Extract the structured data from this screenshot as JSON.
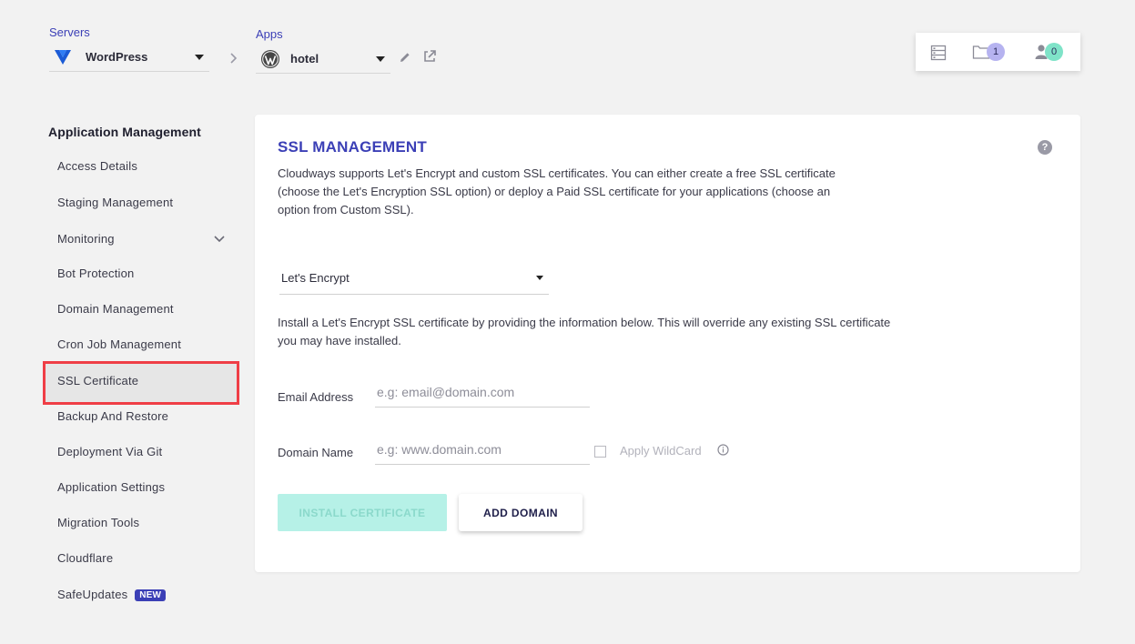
{
  "header": {
    "servers_label": "Servers",
    "server_name": "WordPress",
    "apps_label": "Apps",
    "app_name": "hotel",
    "projects_count": "1",
    "team_count": "0"
  },
  "sidebar": {
    "title": "Application Management",
    "items": [
      {
        "label": "Access Details"
      },
      {
        "label": "Staging Management"
      },
      {
        "label": "Monitoring"
      },
      {
        "label": "Bot Protection"
      },
      {
        "label": "Domain Management"
      },
      {
        "label": "Cron Job Management"
      },
      {
        "label": "SSL Certificate"
      },
      {
        "label": "Backup And Restore"
      },
      {
        "label": "Deployment Via Git"
      },
      {
        "label": "Application Settings"
      },
      {
        "label": "Migration Tools"
      },
      {
        "label": "Cloudflare"
      },
      {
        "label": "SafeUpdates",
        "badge": "NEW"
      }
    ],
    "active": "SSL Certificate"
  },
  "main": {
    "title": "SSL MANAGEMENT",
    "description": "Cloudways supports Let's Encrypt and custom SSL certificates. You can either create a free SSL certificate (choose the Let's Encryption SSL option) or deploy a Paid SSL certificate for your applications (choose an option from Custom SSL).",
    "ssl_type": "Let's Encrypt",
    "install_description": "Install a Let's Encrypt SSL certificate by providing the information below. This will override any existing SSL certificate you may have installed.",
    "email_label": "Email Address",
    "email_placeholder": "e.g: email@domain.com",
    "domain_label": "Domain Name",
    "domain_placeholder": "e.g: www.domain.com",
    "wildcard_label": "Apply WildCard",
    "install_button": "INSTALL CERTIFICATE",
    "add_domain_button": "ADD DOMAIN"
  },
  "colors": {
    "brand": "#3b3fb6",
    "active_outline": "#ef3e46",
    "projects_badge": "#b6b3f0",
    "team_badge": "#7fe3c8",
    "install_bg": "#b6f1e7"
  },
  "icons": [
    "digitalocean-logo-icon",
    "chevron-right-icon",
    "wordpress-logo-icon",
    "pencil-icon",
    "external-link-icon",
    "servers-icon",
    "folder-icon",
    "user-icon",
    "chevron-down-icon",
    "help-icon",
    "info-icon"
  ]
}
